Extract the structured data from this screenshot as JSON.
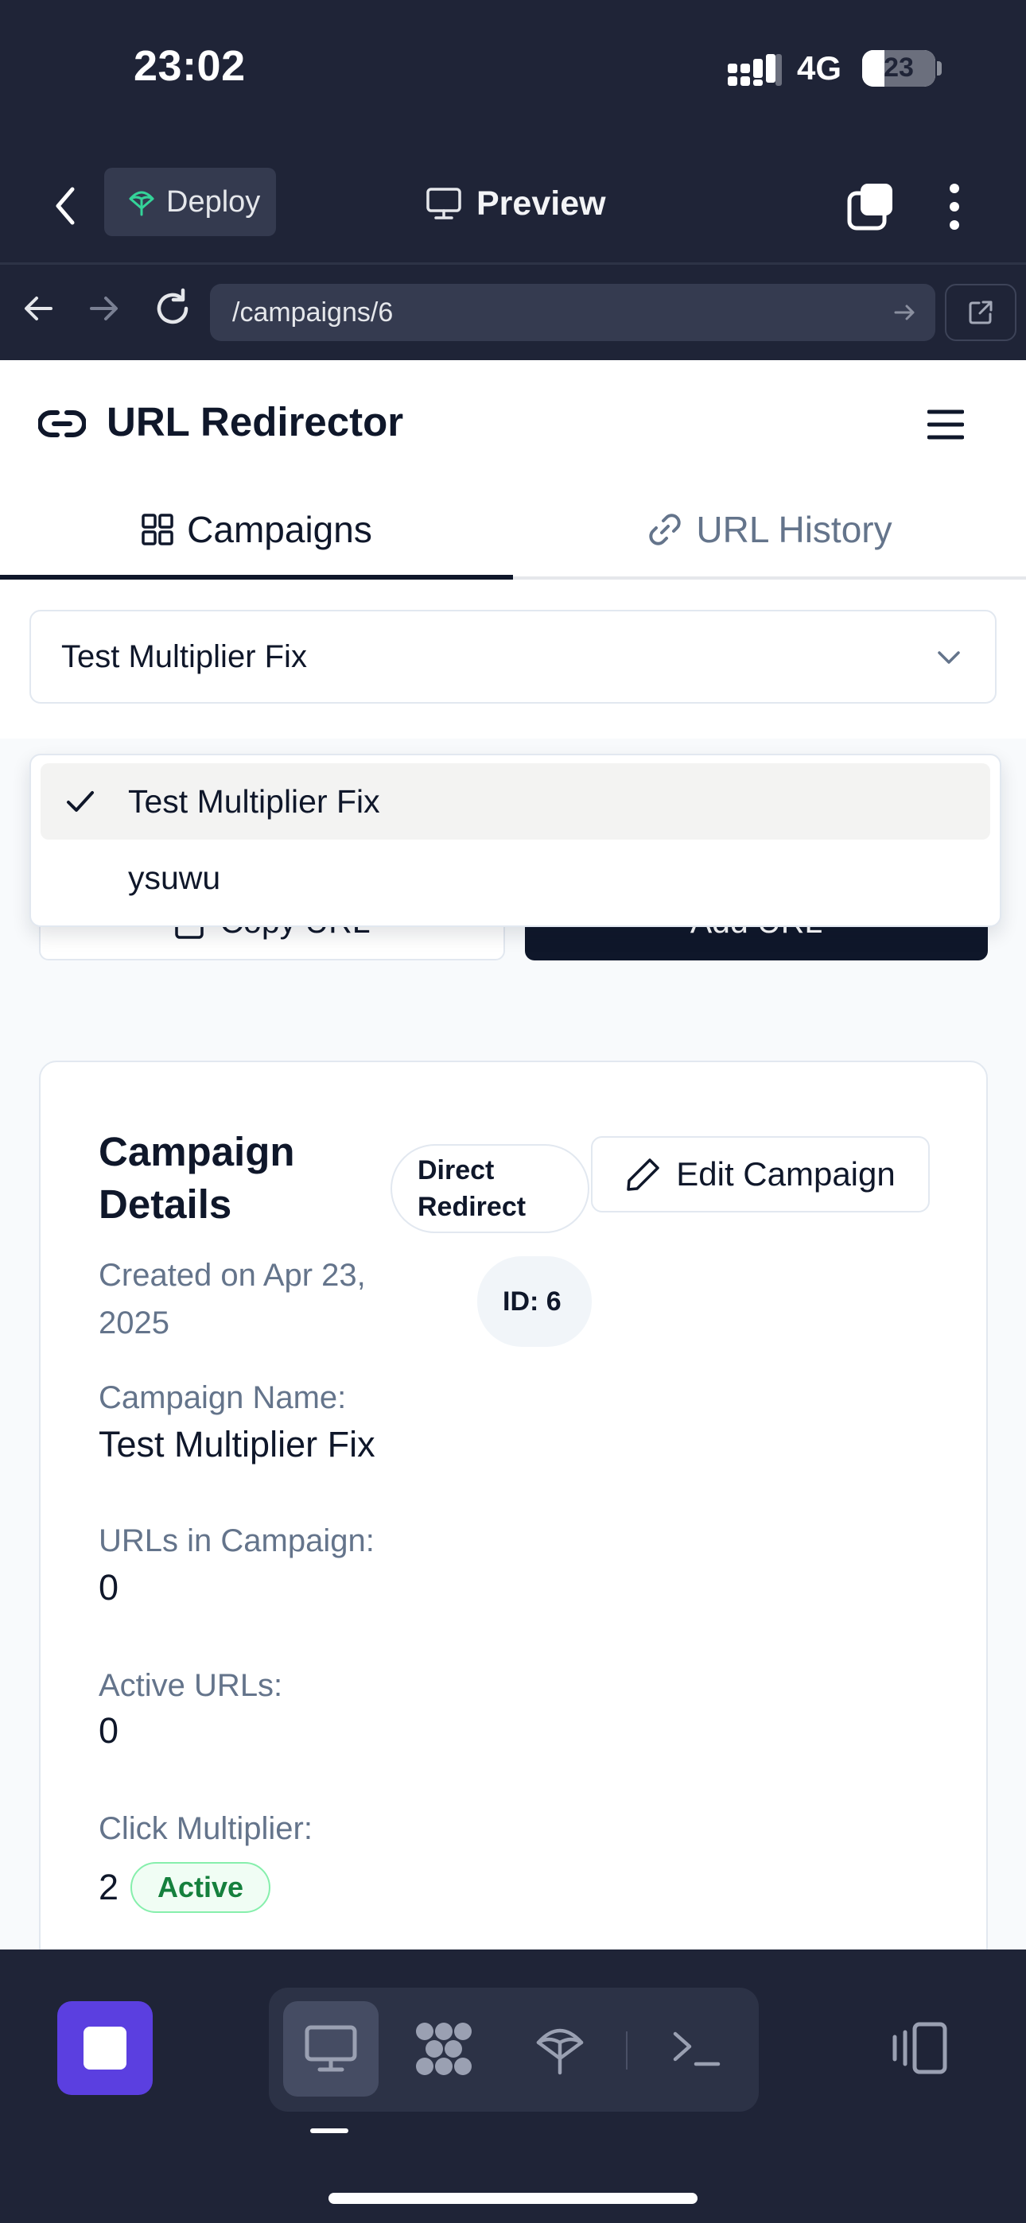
{
  "status_bar": {
    "time": "23:02",
    "network": "4G",
    "battery": "23",
    "battery_level": 0.23
  },
  "app_bar": {
    "deploy_label": "Deploy",
    "preview_label": "Preview"
  },
  "browser": {
    "url": "/campaigns/6"
  },
  "app": {
    "title": "URL Redirector"
  },
  "tabs": [
    {
      "label": "Campaigns",
      "icon": "grid-icon",
      "active": true
    },
    {
      "label": "URL History",
      "icon": "link-icon",
      "active": false
    }
  ],
  "campaign_select": {
    "selected": "Test Multiplier Fix",
    "options": [
      {
        "label": "Test Multiplier Fix",
        "selected": true
      },
      {
        "label": "ysuwu",
        "selected": false
      }
    ]
  },
  "actions": {
    "copy_label": "Copy URL",
    "add_label": "Add URL"
  },
  "card": {
    "title": "Campaign Details",
    "redirect_badge": "Direct Redirect",
    "edit_label": "Edit Campaign",
    "created": "Created on Apr 23, 2025",
    "id_badge": "ID: 6",
    "fields": [
      {
        "label": "Campaign Name:",
        "value": "Test Multiplier Fix"
      },
      {
        "label": "URLs in Campaign:",
        "value": "0"
      },
      {
        "label": "Active URLs:",
        "value": "0"
      },
      {
        "label": "Click Multiplier:",
        "value": "2"
      }
    ],
    "multiplier_status": "Active"
  },
  "colors": {
    "accent": "#5b3fe0",
    "primary": "#0f172a",
    "success": "#15803d",
    "chrome": "#1f2437"
  }
}
